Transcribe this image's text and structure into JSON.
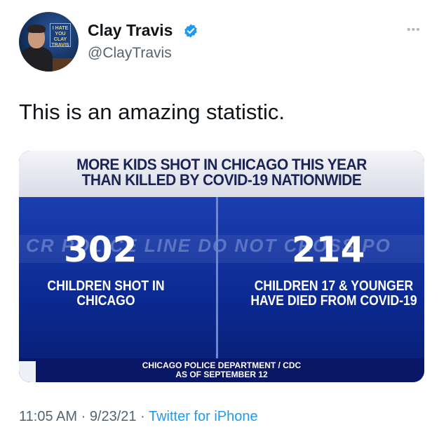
{
  "author": {
    "name": "Clay Travis",
    "handle": "@ClayTravis",
    "avatar_sign_text": "I HATE YOU CLAY TRAVIS",
    "verified_icon": "verified-badge-icon"
  },
  "more_icon": "more-options-icon",
  "tweet": {
    "text": "This is an amazing statistic."
  },
  "media": {
    "headline_line1": "MORE KIDS SHOT IN CHICAGO THIS YEAR",
    "headline_line2": "THAN KILLED BY COVID-19 NATIONWIDE",
    "left_number": "302",
    "left_label_line1": "CHILDREN SHOT IN",
    "left_label_line2": "CHICAGO",
    "right_number": "214",
    "right_label_line1": "CHILDREN 17 & YOUNGER",
    "right_label_line2": "HAVE DIED FROM COVID-19",
    "tape_text": "CR POLICE LINE DO NOT CROSS PO",
    "source_line1": "CHICAGO POLICE DEPARTMENT / CDC",
    "source_line2": "AS OF SEPTEMBER 12"
  },
  "meta": {
    "time": "11:05 AM",
    "sep1": " · ",
    "date": "9/23/21",
    "sep2": " · ",
    "source": "Twitter for iPhone"
  },
  "colors": {
    "accent": "#1d9bf0",
    "text_primary": "#0f1419",
    "text_secondary": "#536471",
    "graphic_blue": "#0c2a94"
  }
}
